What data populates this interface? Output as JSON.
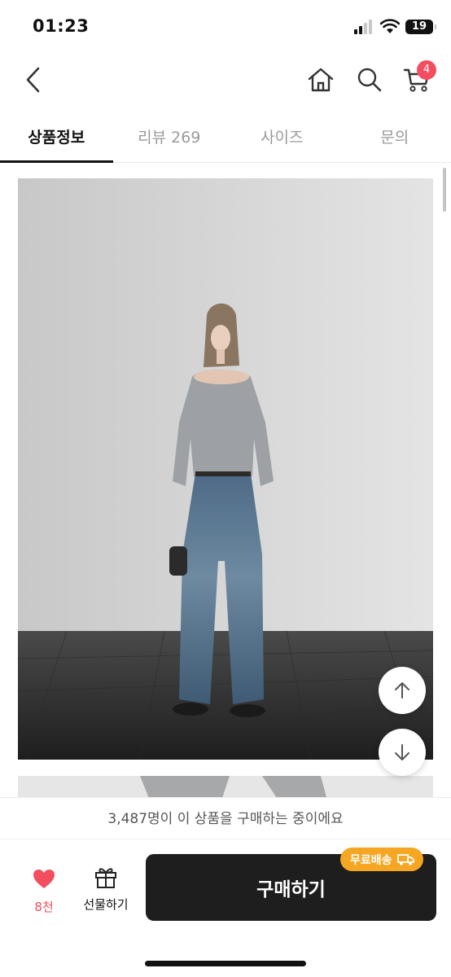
{
  "status_bar": {
    "time": "01:23",
    "battery": "19"
  },
  "nav": {
    "cart_count": "4"
  },
  "tabs": [
    {
      "label": "상품정보"
    },
    {
      "label": "리뷰 269"
    },
    {
      "label": "사이즈"
    },
    {
      "label": "문의"
    }
  ],
  "purchase_notice": "3,487명이 이 상품을 구매하는 중이에요",
  "bottom": {
    "like_count": "8천",
    "gift_label": "선물하기",
    "buy_label": "구매하기",
    "shipping_badge": "무료배송"
  },
  "colors": {
    "accent_red": "#f24e5f",
    "buy_button": "#1e1e1e",
    "shipping_badge": "#f5a623"
  }
}
